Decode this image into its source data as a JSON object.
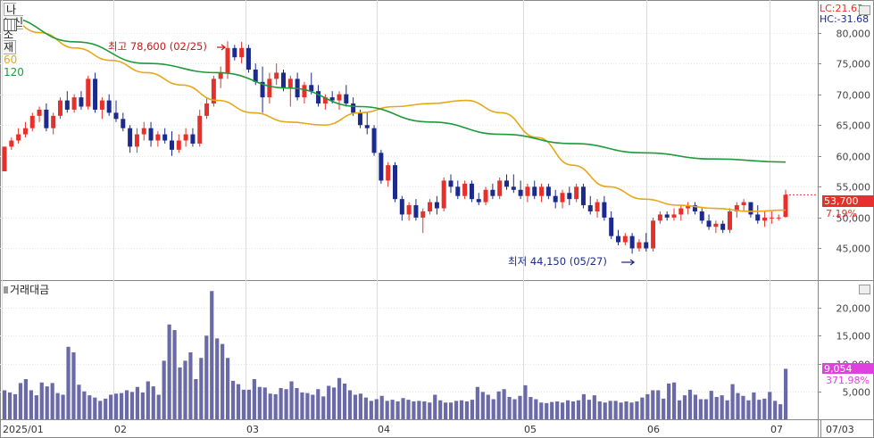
{
  "header": {
    "stock_name": "나노신소재",
    "ma_short": "60",
    "ma_long": "120",
    "lc_label": "LC:21.63",
    "hc_label": "HC:-31.68"
  },
  "colors": {
    "up": "#e8302a",
    "down": "#1b2a8c",
    "ma60": "#e6a817",
    "ma120": "#1e9a3a",
    "volume": "#6b6aa8",
    "price_tag_bg": "#e8302a",
    "volume_tag_bg": "#e040e0",
    "pct_text": "#e8302a"
  },
  "chart_data": [
    {
      "type": "candlestick",
      "title": "나노신소재",
      "ylim": [
        40000,
        85000
      ],
      "yticks": [
        "80,000",
        "75,000",
        "70,000",
        "65,000",
        "60,000",
        "55,000",
        "50,000",
        "45,000"
      ],
      "x_labels": [
        "2025/01",
        "02",
        "03",
        "04",
        "05",
        "06",
        "07",
        "07/03"
      ],
      "annotations": {
        "high": "최고 78,600 (02/25)",
        "low": "최저 44,150 (05/27)"
      },
      "current_price": "53,700",
      "change_pct": "7.19%",
      "candles": [
        [
          57500,
          61500,
          57500,
          61500
        ],
        [
          61500,
          63000,
          61000,
          62500
        ],
        [
          62500,
          64500,
          62000,
          63500
        ],
        [
          63500,
          65500,
          63000,
          64500
        ],
        [
          64500,
          67000,
          64000,
          66500
        ],
        [
          66500,
          68000,
          65500,
          67500
        ],
        [
          67500,
          68500,
          64000,
          64500
        ],
        [
          64500,
          67000,
          63500,
          66500
        ],
        [
          66500,
          69500,
          66000,
          69000
        ],
        [
          69000,
          70500,
          67000,
          67500
        ],
        [
          67500,
          70000,
          67000,
          69500
        ],
        [
          69500,
          70500,
          67500,
          68000
        ],
        [
          68000,
          73000,
          67500,
          72500
        ],
        [
          72500,
          73500,
          67000,
          67500
        ],
        [
          67500,
          69500,
          66000,
          69000
        ],
        [
          69000,
          70000,
          66500,
          67000
        ],
        [
          67000,
          69000,
          65500,
          66000
        ],
        [
          66000,
          67000,
          64000,
          64500
        ],
        [
          64500,
          65000,
          60500,
          61500
        ],
        [
          61500,
          64500,
          60500,
          63500
        ],
        [
          63500,
          65500,
          62500,
          64500
        ],
        [
          64500,
          65500,
          61500,
          62500
        ],
        [
          62500,
          64000,
          61500,
          63500
        ],
        [
          63500,
          64500,
          62000,
          62500
        ],
        [
          62500,
          64000,
          60000,
          61000
        ],
        [
          61000,
          63500,
          60500,
          62500
        ],
        [
          62500,
          64500,
          61500,
          63500
        ],
        [
          63500,
          64500,
          61500,
          62000
        ],
        [
          62000,
          67500,
          61500,
          66500
        ],
        [
          66500,
          69500,
          66000,
          68500
        ],
        [
          68500,
          73000,
          68000,
          72500
        ],
        [
          72500,
          74500,
          71000,
          73500
        ],
        [
          73500,
          78600,
          72500,
          77500
        ],
        [
          77500,
          78000,
          75500,
          76000
        ],
        [
          76000,
          78500,
          75000,
          77500
        ],
        [
          77500,
          78000,
          73500,
          74000
        ],
        [
          74000,
          75000,
          71500,
          72000
        ],
        [
          72000,
          74500,
          67000,
          69500
        ],
        [
          69500,
          73500,
          68500,
          72500
        ],
        [
          72500,
          75000,
          71500,
          73500
        ],
        [
          73500,
          74000,
          70500,
          71000
        ],
        [
          71000,
          73000,
          68000,
          72500
        ],
        [
          72500,
          73500,
          69000,
          69500
        ],
        [
          69500,
          72000,
          68500,
          71500
        ],
        [
          71500,
          73500,
          70000,
          70500
        ],
        [
          70500,
          71500,
          68000,
          68500
        ],
        [
          68500,
          70000,
          67500,
          69500
        ],
        [
          69500,
          70500,
          68500,
          69000
        ],
        [
          69000,
          70500,
          67500,
          70000
        ],
        [
          70000,
          71500,
          68000,
          68500
        ],
        [
          68500,
          69500,
          66500,
          67000
        ],
        [
          67000,
          67500,
          64500,
          65000
        ],
        [
          65000,
          67000,
          63500,
          64500
        ],
        [
          64500,
          65000,
          60000,
          60500
        ],
        [
          60500,
          61000,
          55500,
          56000
        ],
        [
          56000,
          59000,
          55000,
          58500
        ],
        [
          58500,
          59000,
          52500,
          53000
        ],
        [
          53000,
          53500,
          49500,
          50500
        ],
        [
          50500,
          52500,
          49500,
          52000
        ],
        [
          52000,
          53000,
          49500,
          50000
        ],
        [
          50000,
          51500,
          47500,
          51000
        ],
        [
          51000,
          53000,
          50500,
          52500
        ],
        [
          52500,
          53500,
          50500,
          51500
        ],
        [
          51500,
          56500,
          51000,
          56000
        ],
        [
          56000,
          57000,
          54000,
          55000
        ],
        [
          55000,
          56000,
          53000,
          53500
        ],
        [
          53500,
          56000,
          53000,
          55500
        ],
        [
          55500,
          56000,
          52500,
          53000
        ],
        [
          53000,
          54000,
          52000,
          52500
        ],
        [
          52500,
          55000,
          52000,
          54500
        ],
        [
          54500,
          55500,
          53000,
          53500
        ],
        [
          53500,
          56500,
          53000,
          56000
        ],
        [
          56000,
          57000,
          54500,
          55000
        ],
        [
          55000,
          57000,
          54000,
          54500
        ],
        [
          54500,
          56000,
          53000,
          53500
        ],
        [
          53500,
          55500,
          52500,
          55000
        ],
        [
          55000,
          56000,
          53000,
          53500
        ],
        [
          53500,
          55500,
          52500,
          55000
        ],
        [
          55000,
          55500,
          53000,
          53500
        ],
        [
          53500,
          54500,
          51500,
          52500
        ],
        [
          52500,
          54500,
          51500,
          54000
        ],
        [
          54000,
          55000,
          52000,
          53000
        ],
        [
          53000,
          55500,
          52500,
          55000
        ],
        [
          55000,
          55500,
          51500,
          52000
        ],
        [
          52000,
          53500,
          50500,
          51000
        ],
        [
          51000,
          53000,
          50000,
          52500
        ],
        [
          52500,
          53500,
          49500,
          50000
        ],
        [
          50000,
          51000,
          46500,
          47000
        ],
        [
          47000,
          48000,
          45500,
          46000
        ],
        [
          46000,
          47500,
          45500,
          47000
        ],
        [
          47000,
          47500,
          44150,
          45000
        ],
        [
          45000,
          46500,
          44500,
          46000
        ],
        [
          46000,
          47500,
          44500,
          45000
        ],
        [
          45000,
          50000,
          44500,
          49500
        ],
        [
          49500,
          51000,
          49000,
          50500
        ],
        [
          50500,
          51000,
          49500,
          50000
        ],
        [
          50000,
          51500,
          49500,
          50500
        ],
        [
          50500,
          52000,
          49500,
          51500
        ],
        [
          51500,
          52500,
          50500,
          52000
        ],
        [
          52000,
          52500,
          50500,
          51000
        ],
        [
          51000,
          51500,
          49000,
          49500
        ],
        [
          49500,
          50500,
          48000,
          48500
        ],
        [
          48500,
          49500,
          47500,
          49000
        ],
        [
          49000,
          49500,
          47500,
          48000
        ],
        [
          48000,
          51500,
          47500,
          51000
        ],
        [
          51000,
          52500,
          50000,
          52000
        ],
        [
          52000,
          53000,
          51000,
          52500
        ],
        [
          52500,
          52500,
          50000,
          50500
        ],
        [
          50500,
          52000,
          49000,
          49500
        ],
        [
          49500,
          51000,
          48500,
          50000
        ],
        [
          50000,
          51000,
          49000,
          50000
        ],
        [
          50000,
          50500,
          49500,
          50000
        ],
        [
          50100,
          54500,
          50000,
          53700
        ]
      ],
      "ma60": [
        82500,
        80000,
        77500,
        75500,
        73500,
        71500,
        69000,
        67000,
        65500,
        65000,
        67000,
        68000,
        68500,
        69000,
        67000,
        63000,
        58500,
        55000,
        53000,
        52000,
        51500,
        51000,
        51200
      ],
      "ma120": [
        82500,
        78500,
        75000,
        73500,
        71000,
        68000,
        65500,
        63500,
        62000,
        60500,
        59500,
        59000
      ]
    },
    {
      "type": "bar",
      "title": "거래대금",
      "ylim": [
        0,
        24000
      ],
      "yticks": [
        "20,000",
        "15,000",
        "10,000",
        "5,000"
      ],
      "current_value": "9,054",
      "change_pct": "371.98%",
      "values": [
        5200,
        4800,
        4500,
        6500,
        7200,
        5200,
        4300,
        6600,
        5900,
        6500,
        4700,
        4400,
        13000,
        12000,
        6200,
        5000,
        4300,
        3900,
        3300,
        3700,
        4400,
        4600,
        4700,
        5200,
        4900,
        5800,
        4800,
        6800,
        5900,
        4400,
        10500,
        17000,
        16000,
        9300,
        10500,
        12000,
        7200,
        11000,
        15000,
        23000,
        14500,
        13500,
        11000,
        6900,
        6300,
        5300,
        5300,
        7200,
        5800,
        5700,
        4600,
        4500,
        5600,
        5400,
        6800,
        5600,
        4800,
        4700,
        4400,
        5400,
        4100,
        6000,
        5700,
        7400,
        6400,
        5200,
        4400,
        4600,
        3900,
        3300,
        3600,
        4200,
        3300,
        3500,
        3200,
        3800,
        3500,
        3200,
        3300,
        3200,
        3000,
        4400,
        3400,
        3000,
        3000,
        3300,
        3400,
        3200,
        3500,
        5800,
        4900,
        4400,
        3600,
        5000,
        5400,
        4000,
        3600,
        4200,
        6100,
        4000,
        3600,
        3000,
        2900,
        3100,
        3200,
        3000,
        3400,
        3200,
        3400,
        4500,
        3500,
        4300,
        3200,
        3000,
        3300,
        3300,
        3000,
        3200,
        3000,
        3200,
        3900,
        4500,
        5200,
        5200,
        3700,
        6400,
        6600,
        3400,
        4300,
        5300,
        4400,
        3600,
        3600,
        5100,
        4000,
        4300,
        3400,
        6300,
        4700,
        4200,
        3400,
        4800,
        3500,
        3700,
        4900,
        3300,
        2700,
        9054
      ]
    }
  ]
}
